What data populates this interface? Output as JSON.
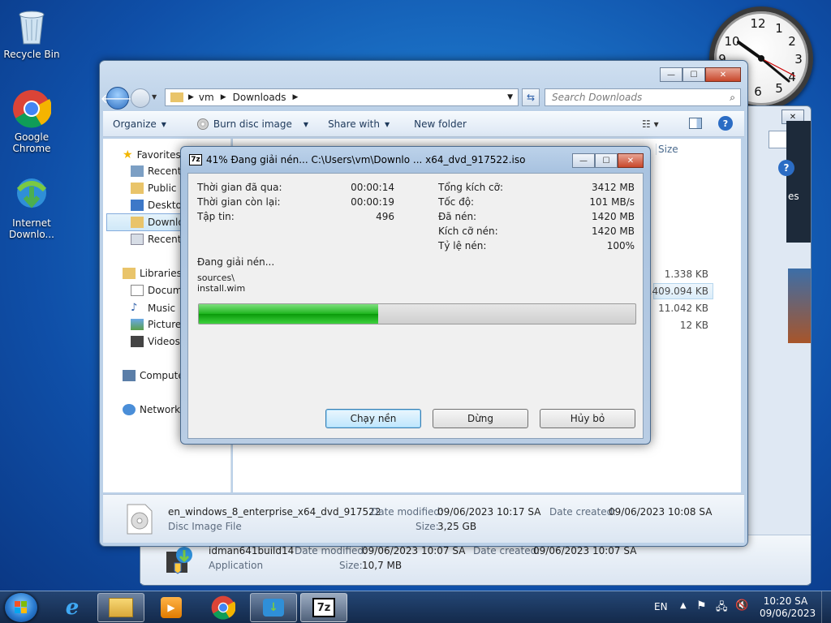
{
  "desktop": {
    "icons": [
      {
        "label": "Recycle Bin"
      },
      {
        "label": "Google Chrome"
      },
      {
        "label": "Internet Downlo..."
      }
    ]
  },
  "clock": {
    "numbers": [
      "12",
      "1",
      "2",
      "3",
      "4",
      "5",
      "6",
      "9",
      "10"
    ]
  },
  "explorer": {
    "path": [
      "vm",
      "Downloads"
    ],
    "search_placeholder": "Search Downloads",
    "toolbar": {
      "organize": "Organize",
      "burn": "Burn disc image",
      "share": "Share with",
      "new_folder": "New folder"
    },
    "column_size": "Size",
    "nav": {
      "favorites": "Favorites",
      "recently": "Recently",
      "public": "Public",
      "desktop": "Desktop",
      "downloads": "Downlo",
      "recent": "Recent",
      "libraries": "Libraries",
      "documents": "Docume",
      "music": "Music",
      "pictures": "Pictures",
      "videos": "Videos",
      "computer": "Compute",
      "network": "Network"
    },
    "sizes": [
      "1.338 KB",
      "3.409.094 KB",
      "11.042 KB",
      "12 KB"
    ],
    "details": {
      "name": "en_windows_8_enterprise_x64_dvd_917522",
      "type": "Disc Image File",
      "modified_label": "Date modified:",
      "modified": "09/06/2023 10:17 SA",
      "created_label": "Date created:",
      "created": "09/06/2023 10:08 SA",
      "size_label": "Size:",
      "size": "3,25 GB"
    }
  },
  "back_window": {
    "details": {
      "name": "idman641build14",
      "type": "Application",
      "modified_label": "Date modified:",
      "modified": "09/06/2023 10:07 SA",
      "created_label": "Date created:",
      "created": "09/06/2023 10:07 SA",
      "size_label": "Size:",
      "size": "10,7 MB"
    },
    "partial_text": "es"
  },
  "dialog": {
    "title": "41% Đang giải nén... C:\\Users\\vm\\Downlo ... x64_dvd_917522.iso",
    "icon_text": "7z",
    "elapsed_label": "Thời gian đã qua:",
    "elapsed": "00:00:14",
    "remaining_label": "Thời gian còn lại:",
    "remaining": "00:00:19",
    "files_label": "Tập tin:",
    "files": "496",
    "total_label": "Tổng kích cỡ:",
    "total": "3412 MB",
    "speed_label": "Tốc độ:",
    "speed": "101 MB/s",
    "processed_label": "Đã nén:",
    "processed": "1420 MB",
    "packed_label": "Kích cỡ nén:",
    "packed": "1420 MB",
    "ratio_label": "Tỷ lệ nén:",
    "ratio": "100%",
    "status": "Đang giải nén...",
    "current_path": "sources\\",
    "current_file": "install.wim",
    "progress": 0.41,
    "btn_background": "Chạy nền",
    "btn_pause": "Dừng",
    "btn_cancel": "Hủy bỏ"
  },
  "taskbar": {
    "lang": "EN",
    "time": "10:20 SA",
    "date": "09/06/2023",
    "sevenzip_label": "7z"
  }
}
